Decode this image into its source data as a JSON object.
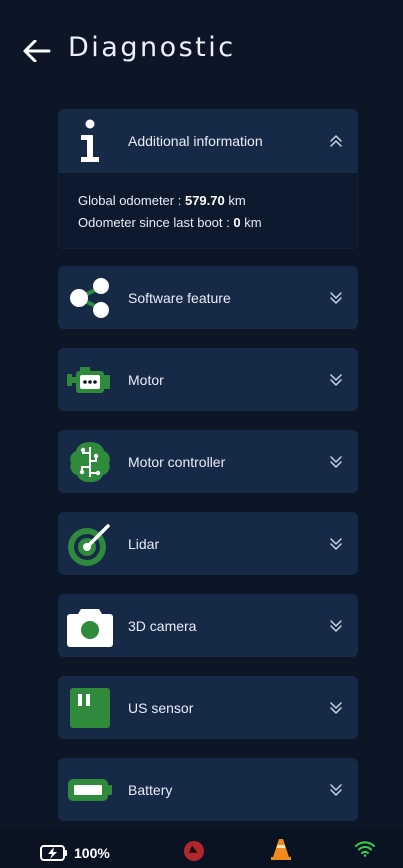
{
  "header": {
    "title": "Diagnostic",
    "back_icon": "arrow-left-icon"
  },
  "sections": [
    {
      "label": "Additional information",
      "icon": "info-icon",
      "expanded": true,
      "details": {
        "global_odometer_label": "Global odometer :",
        "global_odometer_value": "579.70",
        "global_odometer_unit": "km",
        "boot_odometer_label": "Odometer since last boot :",
        "boot_odometer_value": "0",
        "boot_odometer_unit": "km"
      }
    },
    {
      "label": "Software feature",
      "icon": "share-nodes-icon",
      "expanded": false
    },
    {
      "label": "Motor",
      "icon": "engine-icon",
      "expanded": false
    },
    {
      "label": "Motor controller",
      "icon": "brain-circuit-icon",
      "expanded": false
    },
    {
      "label": "Lidar",
      "icon": "radar-icon",
      "expanded": false
    },
    {
      "label": "3D camera",
      "icon": "camera-icon",
      "expanded": false
    },
    {
      "label": "US sensor",
      "icon": "ultrasonic-sensor-icon",
      "expanded": false
    },
    {
      "label": "Battery",
      "icon": "battery-icon",
      "expanded": false
    }
  ],
  "status_bar": {
    "battery_level": "100%",
    "battery_icon": "battery-charging-icon",
    "compass_icon": "compass-icon",
    "cone_icon": "traffic-cone-icon",
    "wifi_icon": "wifi-icon"
  },
  "colors": {
    "background": "#0c1626",
    "card": "#162a48",
    "icon_green": "#2f8a3c",
    "accent_white": "#ffffff",
    "alert_red": "#b3262d",
    "cone_orange": "#f08a1c",
    "wifi_green": "#3ccf4e"
  }
}
